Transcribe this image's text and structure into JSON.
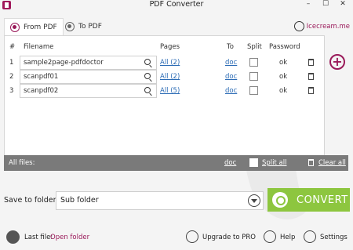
{
  "window": {
    "title": "PDF Converter",
    "minimize": "–",
    "maximize": "☐",
    "close": "✕"
  },
  "tabs": [
    {
      "label": "From PDF"
    },
    {
      "label": "To PDF"
    }
  ],
  "brand": {
    "label": "Icecream.me"
  },
  "table": {
    "headers": {
      "index": "#",
      "filename": "Filename",
      "pages": "Pages",
      "to": "To",
      "split": "Split",
      "password": "Password"
    },
    "rows": [
      {
        "index": "1",
        "filename": "sample2page-pdfdoctor",
        "pages": "All (2)",
        "to": "doc",
        "password": "ok"
      },
      {
        "index": "2",
        "filename": "scanpdf01",
        "pages": "All (2)",
        "to": "doc",
        "password": "ok"
      },
      {
        "index": "3",
        "filename": "scanpdf02",
        "pages": "All (5)",
        "to": "doc",
        "password": "ok"
      }
    ]
  },
  "allfiles": {
    "label": "All files:",
    "format": "doc",
    "split_all": "Split all",
    "clear_all": "Clear all"
  },
  "save": {
    "label": "Save to folder:",
    "value": "Sub folder"
  },
  "convert": {
    "label": "CONVERT"
  },
  "bottom": {
    "last_file_label": "Last file:",
    "open_folder": "Open folder",
    "upgrade": "Upgrade to PRO",
    "help": "Help",
    "settings": "Settings"
  },
  "colors": {
    "accent": "#9a1a5a",
    "convert": "#8dc63f",
    "bar": "#7a7a7a",
    "link": "#2b6bb5"
  }
}
